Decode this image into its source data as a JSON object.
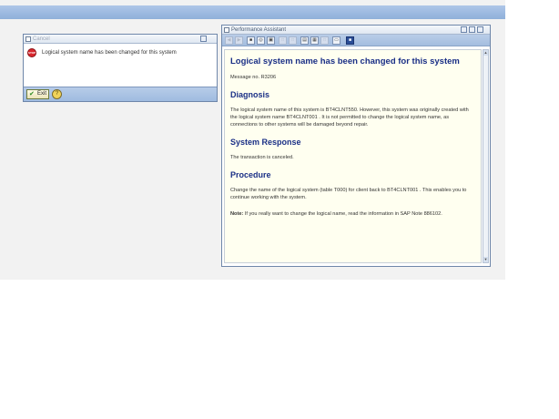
{
  "cancel_dialog": {
    "title": "Cancel",
    "message": "Logical system name has been changed for this system",
    "exit_label": "Exit",
    "stop_icon_text": "STOP"
  },
  "performance_assistant": {
    "title": "Performance Assistant",
    "heading": "Logical system name has been changed for this system",
    "message_no": "Message no. R3206",
    "diagnosis_heading": "Diagnosis",
    "diagnosis_text": "The logical system name of this system is  BT4CLNT550. However, this system was originally created with the logical system name BT4CLNT001 . It is not permitted to change the logical system name, as connections to other systems will be damaged beyond repair.",
    "response_heading": "System Response",
    "response_text": "The transaction is canceled.",
    "procedure_heading": "Procedure",
    "procedure_text": "Change the name of the logical system (table T000) for client  back to BT4CLNT001 . This enables you to continue working with the system.",
    "note_label": "Note:",
    "note_text": " If you really want to change the logical name, read the information in SAP Note 886102."
  },
  "colors": {
    "heading_blue": "#1a2f86",
    "frame_blue": "#6f87aa",
    "body_bg": "#fffff0",
    "stop_red": "#d9272e"
  },
  "icons": [
    "window-icon",
    "stop-icon",
    "checkmark-icon",
    "help-icon",
    "back-icon",
    "forward-icon",
    "print-icon",
    "find-icon",
    "settings-icon",
    "layout-icon",
    "expand-icon",
    "document-icon",
    "info-icon"
  ]
}
